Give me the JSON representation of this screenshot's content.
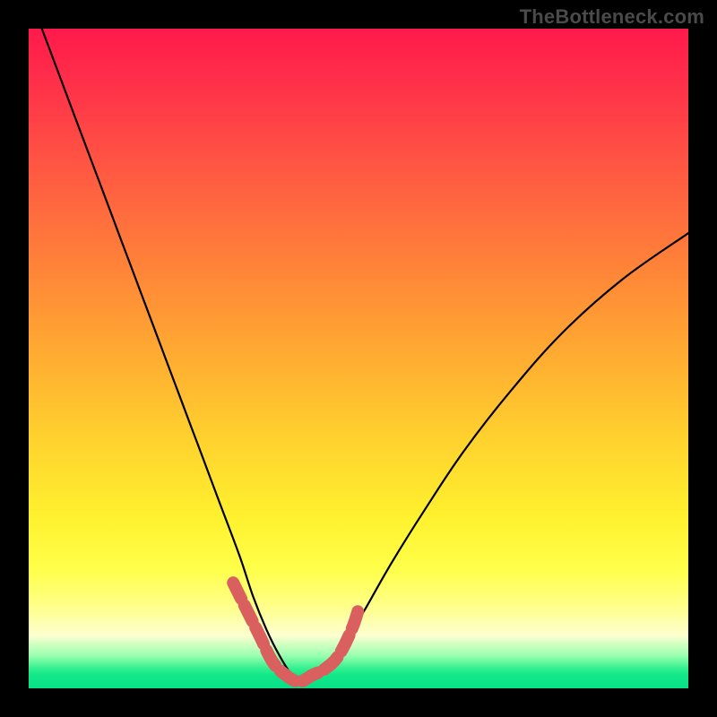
{
  "watermark": "TheBottleneck.com",
  "colors": {
    "curve_stroke": "#000000",
    "highlight_stroke": "#d9605e",
    "background_top": "#ff1a4b",
    "background_bottom": "#08e085",
    "frame": "#000000"
  },
  "chart_data": {
    "type": "line",
    "title": "",
    "xlabel": "",
    "ylabel": "",
    "xlim": [
      0,
      100
    ],
    "ylim": [
      0,
      100
    ],
    "note": "Axes are unlabeled; x/y are normalized 0–100. Curve is a V-shaped dip with minimum near x≈40; a short pink/red highlight overlays the trough segment at the very bottom.",
    "series": [
      {
        "name": "curve",
        "x": [
          2,
          5,
          8,
          11,
          14,
          17,
          20,
          23,
          26,
          29,
          32,
          34,
          36,
          38,
          40,
          42,
          44,
          46,
          48,
          51,
          55,
          60,
          66,
          73,
          81,
          90,
          100
        ],
        "y": [
          100,
          92,
          84,
          76,
          68,
          60,
          52,
          44,
          36,
          28,
          20,
          14,
          9,
          5,
          2,
          1,
          2,
          4,
          7,
          12,
          19,
          27,
          36,
          45,
          54,
          62,
          69
        ]
      },
      {
        "name": "trough-highlight",
        "x": [
          31,
          33,
          35,
          37,
          39,
          41,
          43,
          45,
          47,
          49,
          50
        ],
        "y": [
          16,
          12,
          8,
          4,
          2,
          1,
          2,
          3,
          5,
          9,
          12
        ]
      }
    ]
  }
}
